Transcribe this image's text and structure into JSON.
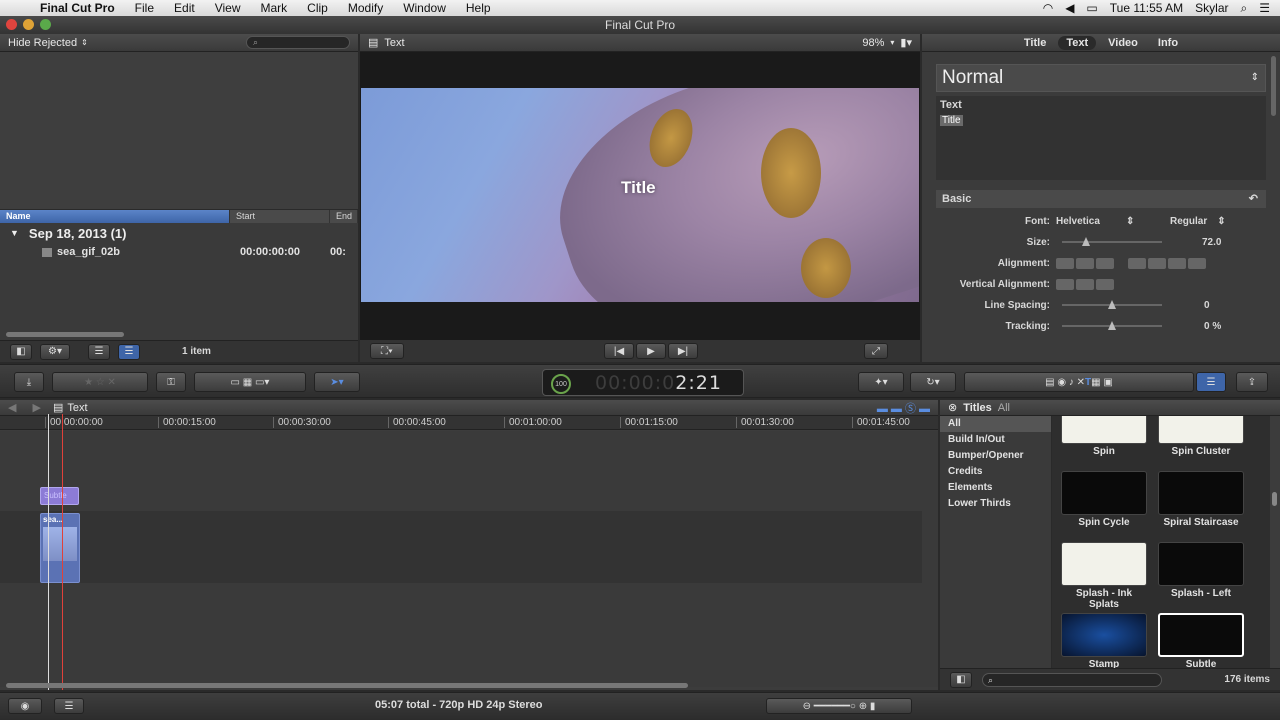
{
  "menubar": {
    "app_name": "Final Cut Pro",
    "items": [
      "File",
      "Edit",
      "View",
      "Mark",
      "Clip",
      "Modify",
      "Window",
      "Help"
    ],
    "clock": "Tue 11:55 AM",
    "user": "Skylar"
  },
  "window": {
    "title": "Final Cut Pro"
  },
  "library": {
    "filter": "Hide Rejected",
    "columns": {
      "name": "Name",
      "start": "Start",
      "end": "End"
    },
    "group": "Sep 18, 2013  (1)",
    "clip": {
      "name": "sea_gif_02b",
      "start": "00:00:00:00",
      "end": "00:"
    },
    "count": "1 item"
  },
  "viewer": {
    "title": "Text",
    "zoom": "98%",
    "overlay_title": "Title"
  },
  "inspector": {
    "tabs": [
      "Title",
      "Text",
      "Video",
      "Info"
    ],
    "active_tab": "Text",
    "preset": "Normal",
    "text_label": "Text",
    "text_value": "Title",
    "section": "Basic",
    "font_label": "Font:",
    "font": "Helvetica",
    "weight": "Regular",
    "size_label": "Size:",
    "size": "72.0",
    "alignment_label": "Alignment:",
    "valign_label": "Vertical Alignment:",
    "line_spacing_label": "Line Spacing:",
    "line_spacing": "0",
    "tracking_label": "Tracking:",
    "tracking": "0 %"
  },
  "timecode": {
    "dim": "00:00:0",
    "lit": "2:21",
    "ring": "100"
  },
  "timeline": {
    "title": "Text",
    "ruler": [
      "00:00:00:00",
      "00:00:15:00",
      "00:00:30:00",
      "00:00:45:00",
      "00:01:00:00",
      "00:01:15:00",
      "00:01:30:00",
      "00:01:45:00"
    ],
    "title_clip": "Subtle",
    "video_clip": "sea..."
  },
  "titles": {
    "header": "Titles",
    "all": "All",
    "categories": [
      "All",
      "Build In/Out",
      "Bumper/Opener",
      "Credits",
      "Elements",
      "Lower Thirds"
    ],
    "tiles": [
      "Spin",
      "Spin Cluster",
      "Spin Cycle",
      "Spiral Staircase",
      "Splash - Ink Splats",
      "Splash - Left",
      "Stamp",
      "Subtle"
    ],
    "count": "176 items"
  },
  "status": {
    "text": "05:07 total - 720p HD 24p Stereo"
  },
  "colors": {
    "accent": "#3e65a8",
    "title_clip": "#8c7bd6",
    "video_clip": "#5b72b4",
    "playhead": "#e0413a"
  }
}
